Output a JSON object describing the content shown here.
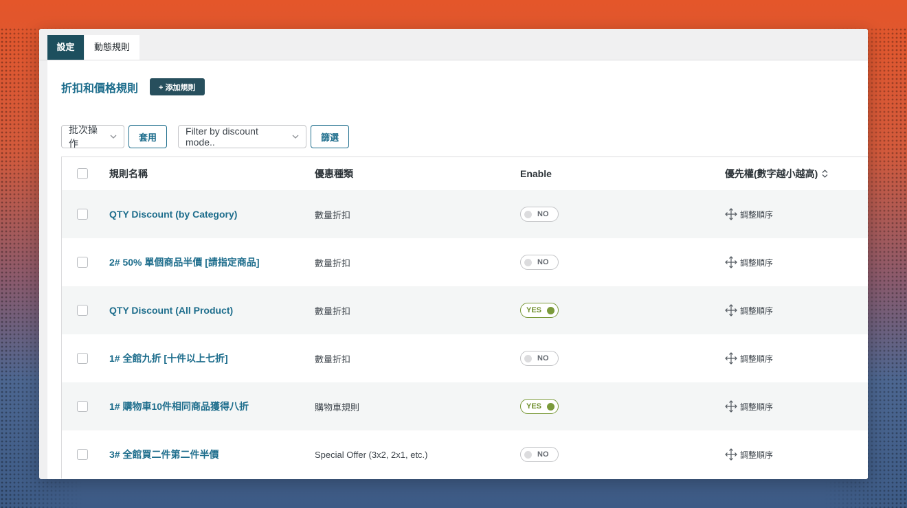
{
  "tabs": [
    {
      "label": "設定",
      "active": true
    },
    {
      "label": "動態規則",
      "active": false
    }
  ],
  "page": {
    "title": "折扣和價格規則",
    "add_button": "+ 添加規則"
  },
  "filters": {
    "bulk_select": "批次操作",
    "apply_button": "套用",
    "mode_select": "Filter by discount mode..",
    "filter_button": "篩選"
  },
  "table": {
    "headers": {
      "name": "規則名稱",
      "type": "優惠種類",
      "enable": "Enable",
      "priority": "優先權(數字越小越高)"
    },
    "rows": [
      {
        "name": "QTY Discount (by Category)",
        "type": "數量折扣",
        "enabled": "NO",
        "action": "調整順序"
      },
      {
        "name": "2# 50% 單個商品半價 [請指定商品]",
        "type": "數量折扣",
        "enabled": "NO",
        "action": "調整順序"
      },
      {
        "name": "QTY Discount (All Product)",
        "type": "數量折扣",
        "enabled": "YES",
        "action": "調整順序"
      },
      {
        "name": "1# 全館九折 [十件以上七折]",
        "type": "數量折扣",
        "enabled": "NO",
        "action": "調整順序"
      },
      {
        "name": "1# 購物車10件相同商品獲得八折",
        "type": "購物車規則",
        "enabled": "YES",
        "action": "調整順序"
      },
      {
        "name": "3# 全館買二件第二件半價",
        "type": "Special Offer (3x2, 2x1, etc.)",
        "enabled": "NO",
        "action": "調整順序"
      }
    ]
  },
  "colors": {
    "accent": "#1d6d8c",
    "tab_active": "#1d4f5e",
    "toggle_on": "#7a9a3a"
  },
  "icons": {
    "move": "move-arrows-icon",
    "sort": "sort-updown-icon",
    "chevron": "chevron-down-icon"
  }
}
